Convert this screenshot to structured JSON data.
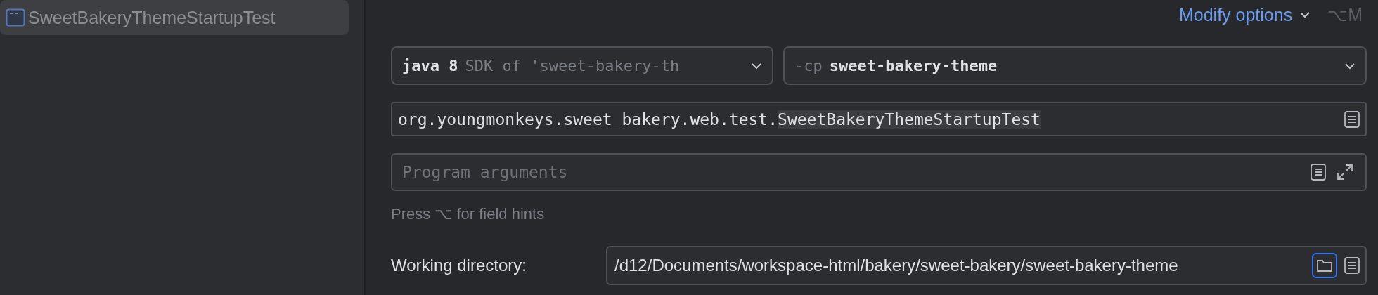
{
  "sidebar": {
    "items": [
      {
        "label": "SweetBakeryThemeStartupTest",
        "selected": true
      }
    ]
  },
  "header": {
    "modify_options": "Modify options",
    "shortcut": "⌥M"
  },
  "jre": {
    "version": "java 8",
    "detail": "SDK of 'sweet-bakery-th"
  },
  "classpath": {
    "flag": "-cp",
    "module": "sweet-bakery-theme"
  },
  "main_class": {
    "prefix": "org.youngmonkeys.sweet_bakery.web.test.",
    "highlighted": "SweetBakeryThemeStartupTest"
  },
  "program_arguments": {
    "placeholder": "Program arguments"
  },
  "hint": "Press ⌥ for field hints",
  "working_directory": {
    "label": "Working directory:",
    "value": "/d12/Documents/workspace-html/bakery/sweet-bakery/sweet-bakery-theme"
  }
}
